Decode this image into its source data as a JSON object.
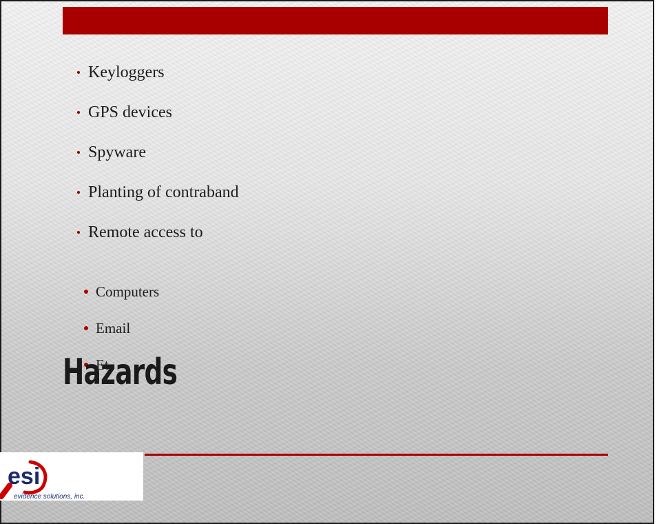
{
  "slide": {
    "title": "Hazards",
    "bullets": [
      {
        "text": "Keyloggers"
      },
      {
        "text": "GPS devices"
      },
      {
        "text": "Spyware"
      },
      {
        "text": "Planting of contraband"
      },
      {
        "text": "Remote access to"
      }
    ],
    "sub_bullets": [
      {
        "text": "Computers"
      },
      {
        "text": "Email"
      },
      {
        "text": "Et"
      }
    ]
  },
  "logo": {
    "wordmark": "esi",
    "tagline": "evidence solutions, inc."
  },
  "colors": {
    "accent_red": "#a80000",
    "logo_red": "#cc0000",
    "logo_navy": "#1a2a6c"
  }
}
